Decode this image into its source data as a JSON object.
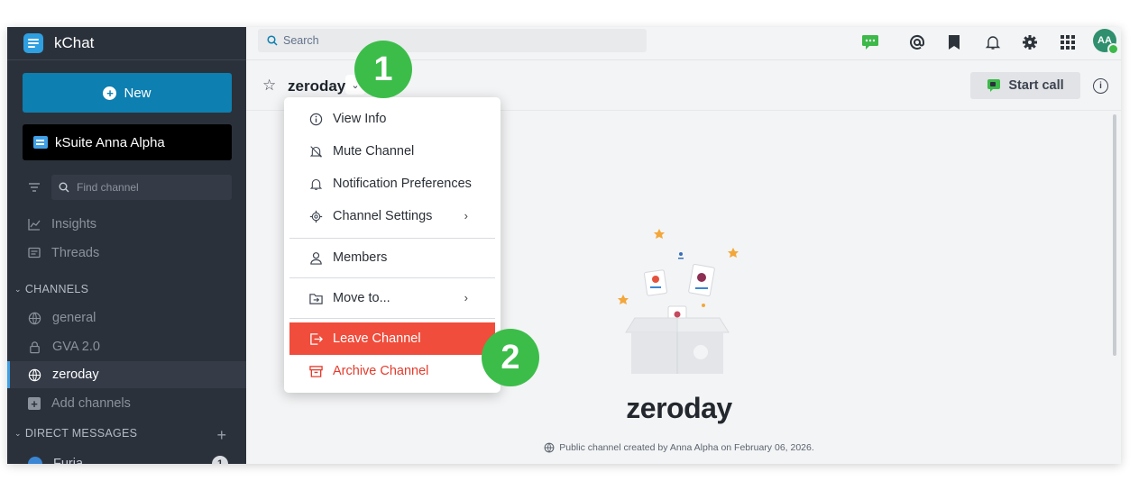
{
  "app": {
    "name": "kChat"
  },
  "sidebar": {
    "new_label": "New",
    "workspace": "kSuite Anna Alpha",
    "find_placeholder": "Find channel",
    "nav": [
      {
        "label": "Insights"
      },
      {
        "label": "Threads"
      }
    ],
    "channels_header": "CHANNELS",
    "channels": [
      {
        "label": "general"
      },
      {
        "label": "GVA 2.0"
      },
      {
        "label": "zeroday"
      }
    ],
    "add_channels": "Add channels",
    "dm_header": "DIRECT MESSAGES",
    "dm_plus": "+",
    "dms": [
      {
        "label": "Furia",
        "badge": "1"
      }
    ]
  },
  "topbar": {
    "search_placeholder": "Search",
    "avatar_initials": "AA"
  },
  "channel": {
    "name": "zeroday",
    "start_call": "Start call"
  },
  "menu": {
    "items": [
      {
        "label": "View Info"
      },
      {
        "label": "Mute Channel"
      },
      {
        "label": "Notification Preferences"
      },
      {
        "label": "Channel Settings",
        "arrow": "›"
      },
      {
        "label": "Members"
      },
      {
        "label": "Move to...",
        "arrow": "›"
      },
      {
        "label": "Leave Channel"
      },
      {
        "label": "Archive Channel"
      }
    ]
  },
  "main": {
    "channel_title": "zeroday",
    "created_text": "Public channel created by Anna Alpha on February 06, 2026."
  },
  "steps": [
    "1",
    "2"
  ],
  "colors": {
    "sidebar_bg": "#2b313b",
    "accent": "#0d7fb0",
    "danger": "#f04d3c",
    "step": "#3cbd4a"
  }
}
